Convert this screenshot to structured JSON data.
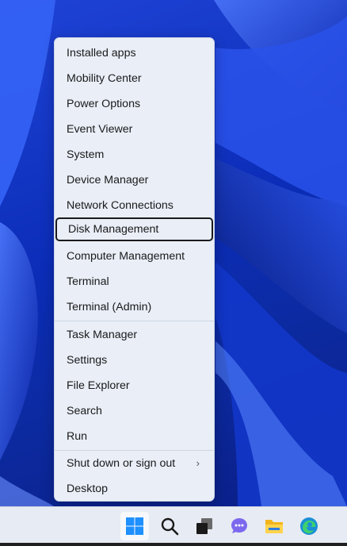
{
  "menu": {
    "items": [
      {
        "label": "Installed apps"
      },
      {
        "label": "Mobility Center"
      },
      {
        "label": "Power Options"
      },
      {
        "label": "Event Viewer"
      },
      {
        "label": "System"
      },
      {
        "label": "Device Manager"
      },
      {
        "label": "Network Connections"
      },
      {
        "label": "Disk Management",
        "selected": true
      },
      {
        "label": "Computer Management"
      },
      {
        "label": "Terminal"
      },
      {
        "label": "Terminal (Admin)"
      },
      {
        "label": "Task Manager"
      },
      {
        "label": "Settings"
      },
      {
        "label": "File Explorer"
      },
      {
        "label": "Search"
      },
      {
        "label": "Run"
      },
      {
        "label": "Shut down or sign out",
        "submenu": true
      },
      {
        "label": "Desktop"
      }
    ],
    "submenu_indicator": "›"
  },
  "taskbar": {
    "icons": [
      {
        "name": "start-icon",
        "active": true
      },
      {
        "name": "search-icon"
      },
      {
        "name": "task-view-icon"
      },
      {
        "name": "chat-icon"
      },
      {
        "name": "file-explorer-icon"
      },
      {
        "name": "edge-icon"
      }
    ]
  },
  "colors": {
    "menu_bg": "#e9eef7",
    "wallpaper": "#1f43d6",
    "selection_border": "#1b1b1b"
  }
}
